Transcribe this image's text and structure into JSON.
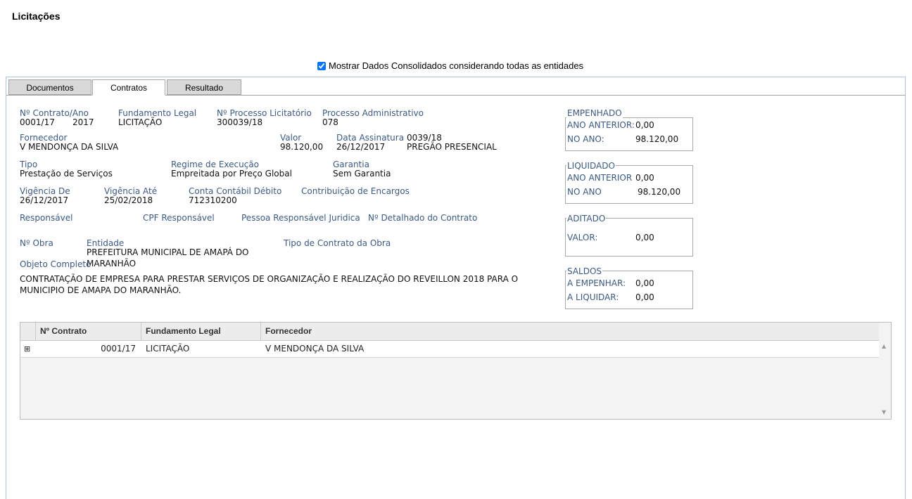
{
  "page": {
    "title": "Licitações"
  },
  "consolidated": {
    "checked": true,
    "label": "Mostrar Dados Consolidados considerando todas as entidades"
  },
  "tabs": [
    {
      "label": "Documentos",
      "active": false
    },
    {
      "label": "Contratos",
      "active": true
    },
    {
      "label": "Resultado",
      "active": false
    }
  ],
  "contract": {
    "numero_label": "Nº Contrato/Ano",
    "numero": "0001/17",
    "ano": "2017",
    "fundamento_label": "Fundamento Legal",
    "fundamento": "LICITAÇÃO",
    "processo_label": "Nº Processo Licitatório",
    "processo": "300039/18",
    "proc_adm_label": "Processo Administrativo",
    "proc_adm": "078",
    "fornecedor_label": "Fornecedor",
    "fornecedor": "V MENDONÇA DA SILVA",
    "valor_label": "Valor",
    "valor": "98.120,00",
    "data_assinatura_label": "Data Assinatura",
    "data_assinatura": "26/12/2017",
    "modalidade_num": "0039/18",
    "modalidade": "PREGÃO PRESENCIAL",
    "tipo_label": "Tipo",
    "tipo": "Prestação de Serviços",
    "regime_label": "Regime de Execução",
    "regime": "Empreitada por Preço Global",
    "garantia_label": "Garantia",
    "garantia": "Sem Garantia",
    "vig_de_label": "Vigência De",
    "vig_de": "26/12/2017",
    "vig_ate_label": "Vigência Até",
    "vig_ate": "25/02/2018",
    "conta_label": "Conta Contábil Débito",
    "conta": "712310200",
    "contrib_label": "Contribuição de Encargos",
    "responsavel_label": "Responsável",
    "cpf_label": "CPF Responsável",
    "pessoa_juridica_label": "Pessoa Responsável Juridica",
    "detalhado_label": "Nº Detalhado do Contrato",
    "obra_label": "Nº Obra",
    "entidade_label": "Entidade",
    "entidade_line1": "PREFEITURA MUNICIPAL DE AMAPÁ DO",
    "entidade_line2": "MARANHÃO",
    "tipo_obra_label": "Tipo de Contrato da Obra",
    "objeto_label": "Objeto Completo",
    "objeto_line1": "CONTRATAÇÃO DE EMPRESA PARA PRESTAR SERVIÇOS DE ORGANIZAÇÃO E REALIZAÇÃO DO REVEILLON 2018 PARA O",
    "objeto_line2": "MUNICIPIO DE AMAPA DO MARANHÃO."
  },
  "summary": {
    "empenhado": {
      "title": "EMPENHADO",
      "ano_anterior_label": "ANO ANTERIOR:",
      "ano_anterior": "0,00",
      "no_ano_label": "NO ANO:",
      "no_ano": "98.120,00"
    },
    "liquidado": {
      "title": "LIQUIDADO",
      "ano_anterior_label": "ANO ANTERIOR",
      "ano_anterior": "0,00",
      "no_ano_label": "NO ANO",
      "no_ano": "98.120,00"
    },
    "aditado": {
      "title": "ADITADO",
      "valor_label": "VALOR:",
      "valor": "0,00"
    },
    "saldos": {
      "title": "SALDOS",
      "empenhar_label": "A EMPENHAR:",
      "empenhar": "0,00",
      "liquidar_label": "A LIQUIDAR:",
      "liquidar": "0,00"
    }
  },
  "grid": {
    "columns": [
      "Nº Contrato",
      "Fundamento Legal",
      "Fornecedor"
    ],
    "rows": [
      {
        "expand": "⊞",
        "numero": "0001/17",
        "fundamento": "LICITAÇÃO",
        "fornecedor": "V MENDONÇA DA SILVA"
      }
    ],
    "scroll_up": "▲",
    "scroll_down": "▼"
  }
}
